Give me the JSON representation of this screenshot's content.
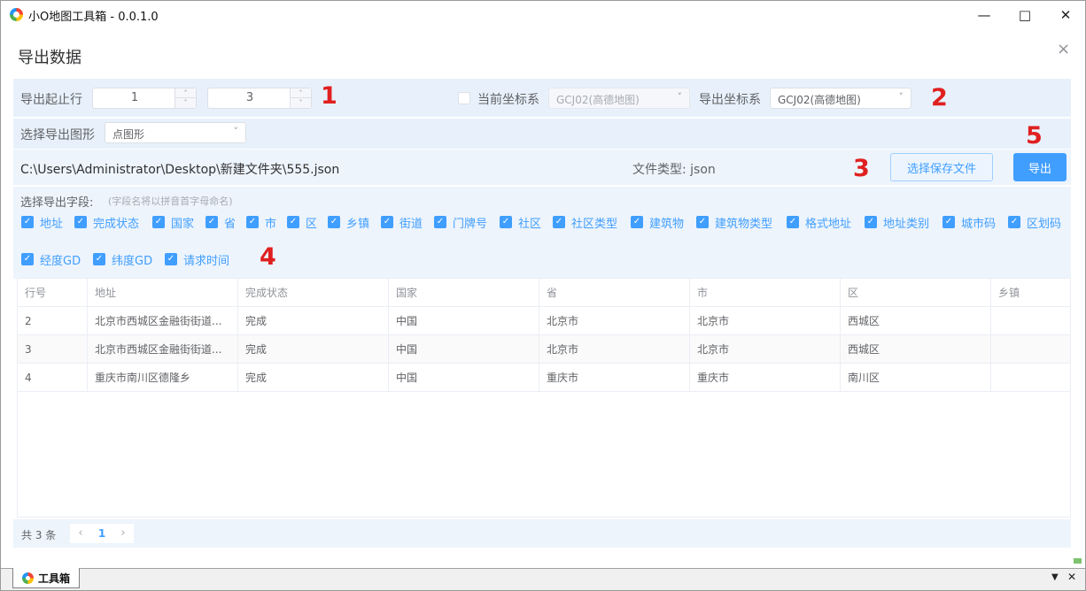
{
  "window": {
    "title": "小O地图工具箱 - 0.0.1.0"
  },
  "dialog": {
    "title": "导出数据",
    "close": "×"
  },
  "row_range": {
    "label": "导出起止行",
    "start": "1",
    "end": "3"
  },
  "coord": {
    "current_label": "当前坐标系",
    "current_value": "GCJ02(高德地图)",
    "export_label": "导出坐标系",
    "export_value": "GCJ02(高德地图)"
  },
  "shape": {
    "label": "选择导出图形",
    "value": "点图形"
  },
  "file": {
    "path": "C:\\Users\\Administrator\\Desktop\\新建文件夹\\555.json",
    "type_label": "文件类型: json"
  },
  "buttons": {
    "choose_file": "选择保存文件",
    "export": "导出"
  },
  "markers": {
    "m1": "1",
    "m2": "2",
    "m3": "3",
    "m4": "4",
    "m5": "5"
  },
  "fields": {
    "title": "选择导出字段:",
    "hint": "(字段名将以拼音首字母命名)",
    "items": [
      "地址",
      "完成状态",
      "国家",
      "省",
      "市",
      "区",
      "乡镇",
      "街道",
      "门牌号",
      "社区",
      "社区类型",
      "建筑物",
      "建筑物类型",
      "格式地址",
      "地址类别",
      "城市码",
      "区划码",
      "经度GD",
      "纬度GD",
      "请求时间"
    ],
    "checked": true
  },
  "table": {
    "headers": [
      "行号",
      "地址",
      "完成状态",
      "国家",
      "省",
      "市",
      "区",
      "乡镇"
    ],
    "rows": [
      [
        "2",
        "北京市西城区金融街街道...",
        "完成",
        "中国",
        "北京市",
        "北京市",
        "西城区",
        ""
      ],
      [
        "3",
        "北京市西城区金融街街道...",
        "完成",
        "中国",
        "北京市",
        "北京市",
        "西城区",
        ""
      ],
      [
        "4",
        "重庆市南川区德隆乡",
        "完成",
        "中国",
        "重庆市",
        "重庆市",
        "南川区",
        ""
      ]
    ]
  },
  "pager": {
    "total": "共 3 条",
    "prev": "‹",
    "current": "1",
    "next": "›"
  },
  "tabbar": {
    "tab_label": "工具箱",
    "down": "▼",
    "close": "✕"
  },
  "colors": {
    "primary": "#409eff",
    "band": "#e8f1fb",
    "marker": "#e02020"
  },
  "icons": {
    "logo": "app-logo-icon",
    "check": "check-icon",
    "chevron": "chevron-down-icon"
  }
}
